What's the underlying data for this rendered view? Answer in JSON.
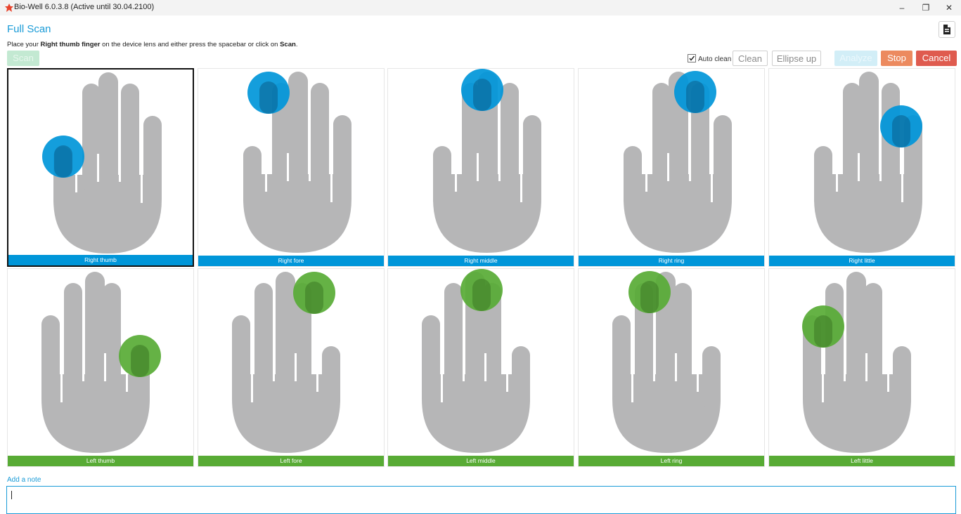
{
  "window": {
    "title": "Bio-Well 6.0.3.8 (Active until 30.04.2100)",
    "minimize_icon": "minimize-icon",
    "maximize_icon": "restore-icon",
    "close_icon": "close-icon"
  },
  "header": {
    "title": "Full Scan",
    "report_icon": "document-icon"
  },
  "instruction": {
    "prefix": "Place your ",
    "finger": "Right thumb finger",
    "middle": " on the device lens and either press the spacebar or click on ",
    "action": "Scan",
    "suffix": "."
  },
  "toolbar": {
    "scan_label": "Scan",
    "auto_clean_label": "Auto clean",
    "auto_clean_checked": true,
    "clean_label": "Clean",
    "ellipse_label": "Ellipse up",
    "analyze_label": "Analyze",
    "stop_label": "Stop",
    "cancel_label": "Cancel"
  },
  "colors": {
    "right_hand": "#0096d9",
    "left_hand": "#58ab35",
    "hand_fill": "#b6b6b7",
    "accent": "#1a9bd7",
    "stop": "#ec8a5f",
    "cancel": "#df5b4f"
  },
  "fingers": {
    "right": [
      {
        "label": "Right thumb",
        "selected": true
      },
      {
        "label": "Right fore",
        "selected": false
      },
      {
        "label": "Right middle",
        "selected": false
      },
      {
        "label": "Right ring",
        "selected": false
      },
      {
        "label": "Right little",
        "selected": false
      }
    ],
    "left": [
      {
        "label": "Left thumb",
        "selected": false
      },
      {
        "label": "Left fore",
        "selected": false
      },
      {
        "label": "Left middle",
        "selected": false
      },
      {
        "label": "Left ring",
        "selected": false
      },
      {
        "label": "Left little",
        "selected": false
      }
    ]
  },
  "note": {
    "label": "Add a note",
    "value": ""
  }
}
